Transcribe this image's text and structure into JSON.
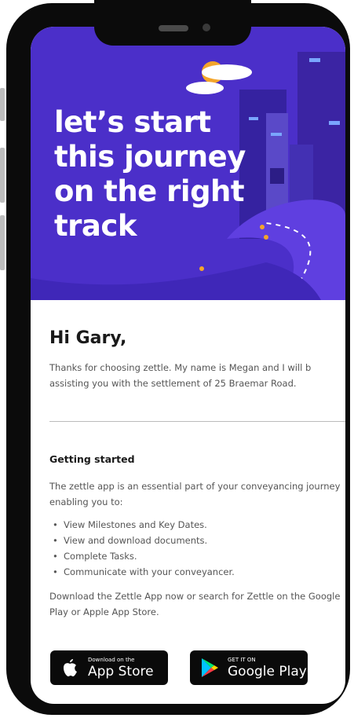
{
  "hero": {
    "title_lines": [
      "let’s start",
      "this journey",
      "on the right",
      "track"
    ]
  },
  "email": {
    "greeting": "Hi Gary,",
    "intro_lines": [
      "Thanks for choosing zettle. My name is Megan and I will b",
      "assisting you with the settlement of 25 Braemar Road."
    ],
    "section_title": "Getting started",
    "para1": "The zettle app is an essential part of your conveyancing journey enabling you to:",
    "bullets": [
      "View Milestones and Key Dates.",
      "View and download documents.",
      "Complete Tasks.",
      "Communicate with your conveyancer."
    ],
    "para2": "Download the Zettle App now or search for Zettle on the Google Play or Apple App Store."
  },
  "stores": {
    "apple_small": "Download on the",
    "apple_big": "App Store",
    "apple_icon": "apple-icon",
    "google_small": "GET IT ON",
    "google_big": "Google Play",
    "google_icon": "google-play-icon"
  },
  "colors": {
    "hero_bg": "#4b2fc9",
    "phone_body": "#0b0b0b",
    "sun": "#f4a52b"
  }
}
